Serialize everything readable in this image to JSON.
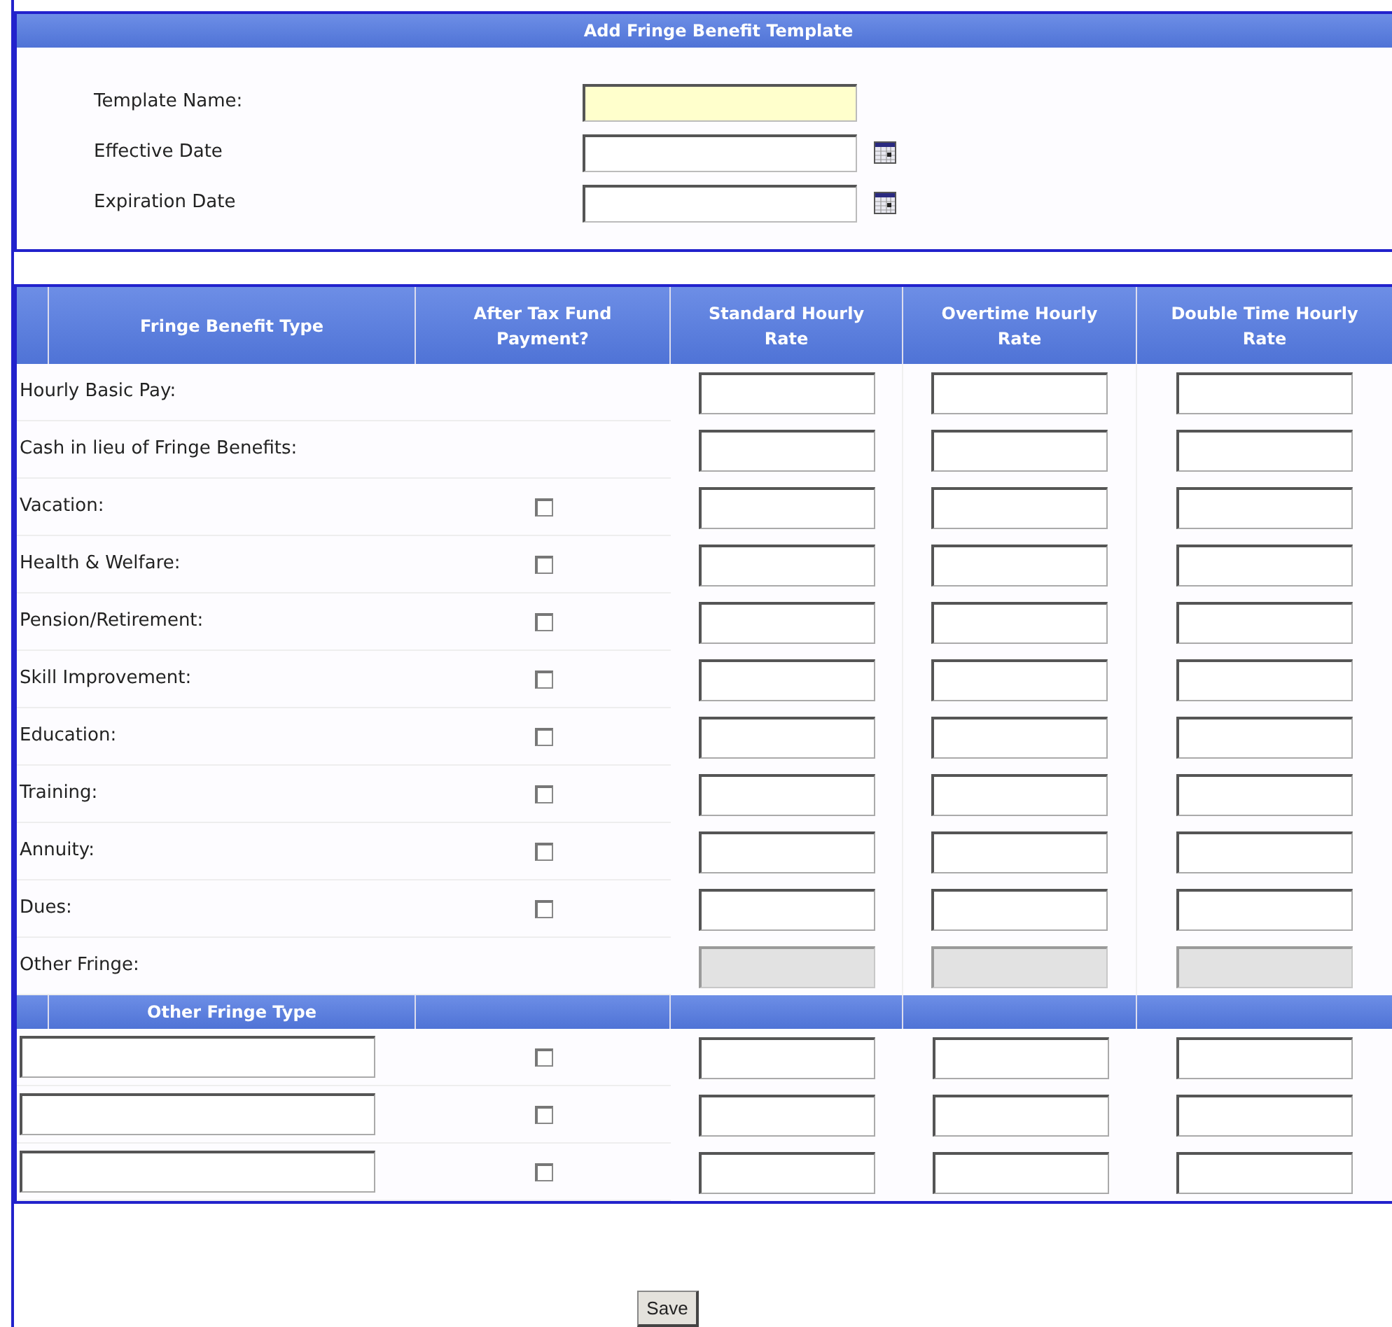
{
  "title": "Add Fringe Benefit Template",
  "template_fields": [
    {
      "label": "Template Name:",
      "kind": "text",
      "highlighted": true
    },
    {
      "label": "Effective Date",
      "kind": "date",
      "highlighted": false
    },
    {
      "label": "Expiration Date",
      "kind": "date",
      "highlighted": false
    }
  ],
  "table": {
    "columns": [
      "Fringe Benefit Type",
      "After Tax Fund Payment?",
      "Standard Hourly Rate",
      "Overtime Hourly Rate",
      "Double Time Hourly Rate"
    ],
    "rows": [
      {
        "label": "Hourly Basic Pay:",
        "kind": "plain",
        "disabled": false
      },
      {
        "label": "Cash in lieu of Fringe Benefits:",
        "kind": "plain",
        "disabled": false
      },
      {
        "label": "Vacation:",
        "kind": "checkbox",
        "checked": false,
        "disabled": false
      },
      {
        "label": "Health & Welfare:",
        "kind": "checkbox",
        "checked": false,
        "disabled": false
      },
      {
        "label": "Pension/Retirement:",
        "kind": "checkbox",
        "checked": false,
        "disabled": false
      },
      {
        "label": "Skill Improvement:",
        "kind": "checkbox",
        "checked": false,
        "disabled": false
      },
      {
        "label": "Education:",
        "kind": "checkbox",
        "checked": false,
        "disabled": false
      },
      {
        "label": "Training:",
        "kind": "checkbox",
        "checked": false,
        "disabled": false
      },
      {
        "label": "Annuity:",
        "kind": "checkbox",
        "checked": false,
        "disabled": false
      },
      {
        "label": "Dues:",
        "kind": "checkbox",
        "checked": false,
        "disabled": false
      },
      {
        "label": "Other Fringe:",
        "kind": "plain",
        "disabled": true
      }
    ],
    "other_header": "Other Fringe Type",
    "other_rows": [
      {
        "checked": false
      },
      {
        "checked": false
      },
      {
        "checked": false
      }
    ]
  },
  "save_button": "Save"
}
